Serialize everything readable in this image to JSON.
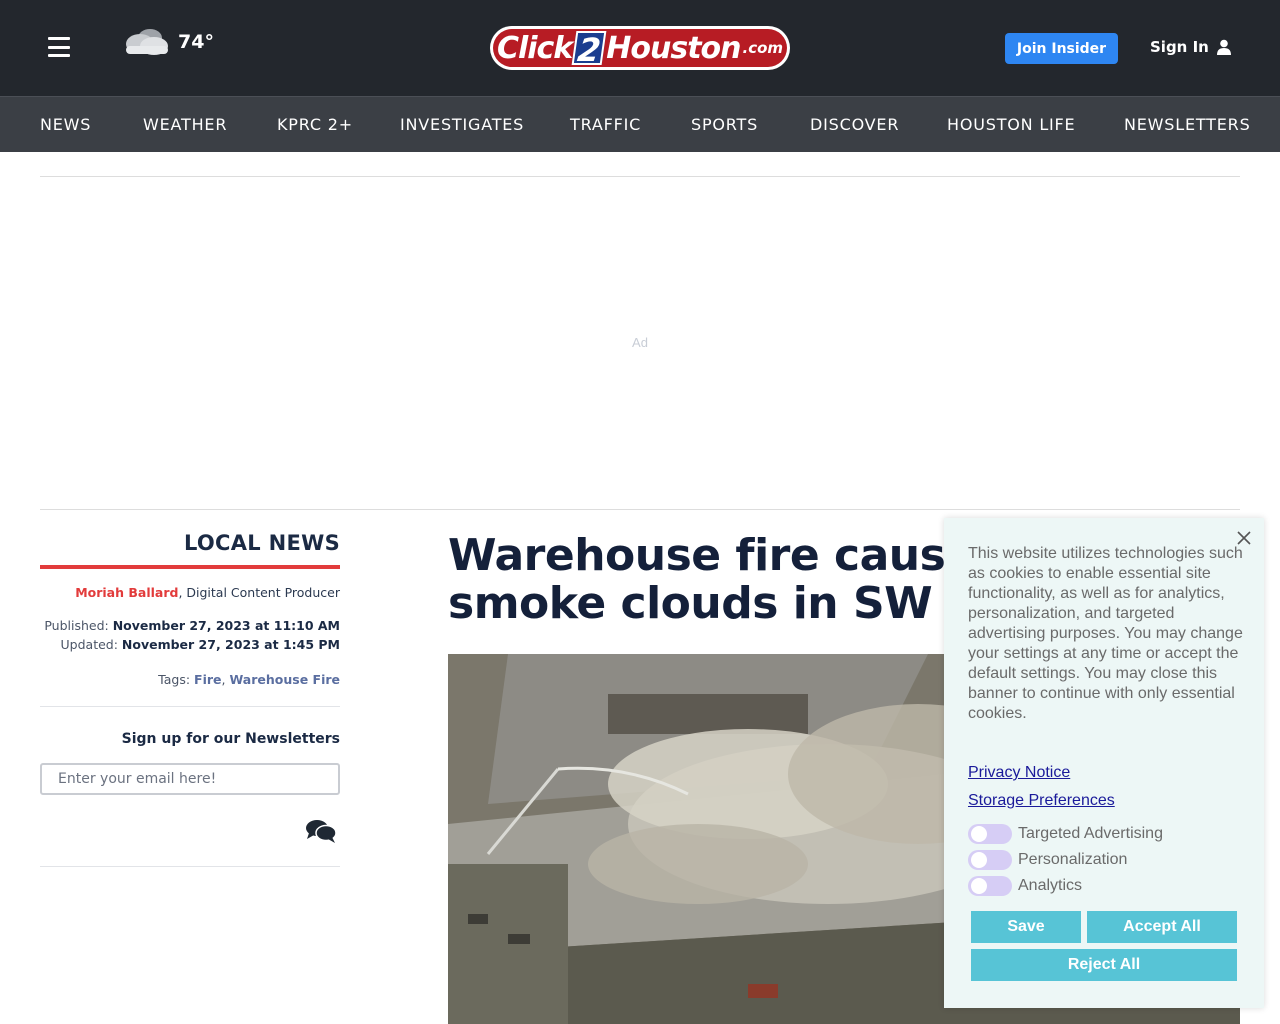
{
  "header": {
    "weather_temp": "74°",
    "logo": {
      "click": "Click",
      "two": "2",
      "houston": "Houston",
      "com": ".com"
    },
    "join_label": "Join Insider",
    "signin_label": "Sign In"
  },
  "nav": {
    "items": [
      "NEWS",
      "WEATHER",
      "KPRC 2+",
      "INVESTIGATES",
      "TRAFFIC",
      "SPORTS",
      "DISCOVER",
      "HOUSTON LIFE",
      "NEWSLETTERS"
    ]
  },
  "ad": {
    "label": "Ad"
  },
  "sidebar": {
    "section": "LOCAL NEWS",
    "author": "Moriah Ballard",
    "author_role": ", Digital Content Producer",
    "published_label": "Published: ",
    "published": "November 27, 2023 at 11:10 AM",
    "updated_label": "Updated: ",
    "updated": "November 27, 2023 at 1:45 PM",
    "tags_label": "Tags: ",
    "tags": [
      "Fire",
      "Warehouse Fire"
    ],
    "newsletter_title": "Sign up for our Newsletters",
    "newsletter_placeholder": "Enter your email here!"
  },
  "article": {
    "headline_line1": "Warehouse fire cause",
    "headline_line2": "smoke clouds in SW H"
  },
  "cookie": {
    "text": "This website utilizes technologies such as cookies to enable essential site functionality, as well as for analytics, personalization, and targeted advertising purposes. You may change your settings at any time or accept the default settings. You may close this banner to continue with only essential cookies.",
    "privacy_link": "Privacy Notice",
    "storage_link": "Storage Preferences",
    "toggles": [
      "Targeted Advertising",
      "Personalization",
      "Analytics"
    ],
    "save_label": "Save",
    "accept_label": "Accept All",
    "reject_label": "Reject All"
  },
  "colors": {
    "header_bg": "#23272d",
    "nav_bg": "#3b3f45",
    "accent_red": "#e23b3b",
    "join_blue": "#2e86f2",
    "cookie_btn": "#57c4d6"
  }
}
